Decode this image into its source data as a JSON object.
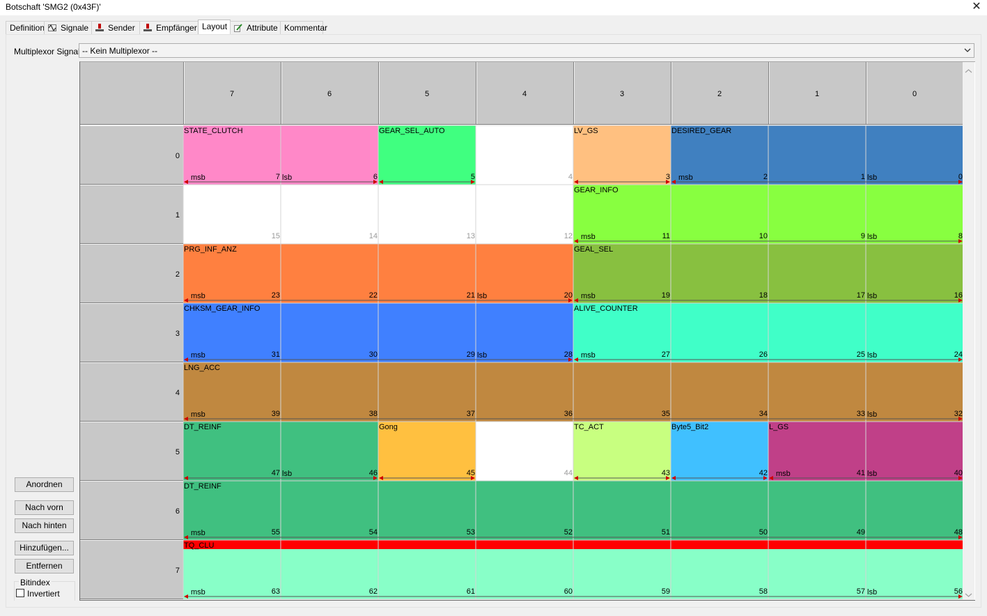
{
  "window": {
    "title": "Botschaft 'SMG2 (0x43F)'",
    "close": "✕"
  },
  "tabs": [
    {
      "label": "Definition",
      "icon": "",
      "active": false
    },
    {
      "label": "Signale",
      "icon": "signal-icon",
      "active": false
    },
    {
      "label": "Sender",
      "icon": "ecu-node-icon",
      "active": false
    },
    {
      "label": "Empfänger",
      "icon": "ecu-node-icon",
      "active": false
    },
    {
      "label": "Layout",
      "icon": "",
      "active": true
    },
    {
      "label": "Attribute",
      "icon": "pencil-edit-icon",
      "active": false
    },
    {
      "label": "Kommentar",
      "icon": "",
      "active": false
    }
  ],
  "multiplexor": {
    "label": "Multiplexor Signal:",
    "value": "-- Kein Multiplexor --"
  },
  "buttons": {
    "arrange": "Anordnen",
    "front": "Nach vorn",
    "back": "Nach hinten",
    "add": "Hinzufügen...",
    "remove": "Entfernen"
  },
  "bitindex": {
    "group": "Bitindex",
    "invert": "Invertiert",
    "checked": false
  },
  "layout": {
    "bit_headers": [
      "7",
      "6",
      "5",
      "4",
      "3",
      "2",
      "1",
      "0"
    ],
    "byte_headers": [
      "0",
      "1",
      "2",
      "3",
      "4",
      "5",
      "6",
      "7"
    ],
    "msb_label": "msb",
    "lsb_label": "lsb",
    "colors": {
      "empty_cell": "#ffffff",
      "header": "#c8c8c8",
      "grid_line": "#d4d4d4",
      "arrow": "#d00000",
      "tq_clu_bar": "#ff0000"
    },
    "signals": [
      {
        "name": "STATE_CLUTCH",
        "byte": 0,
        "from_col": 0,
        "to_col": 1,
        "color": "#ff88c8",
        "msb_col": 0,
        "lsb_col": 1
      },
      {
        "name": "GEAR_SEL_AUTO",
        "byte": 0,
        "from_col": 2,
        "to_col": 2,
        "color": "#40ff80",
        "msb_col": null,
        "lsb_col": null
      },
      {
        "name": "LV_GS",
        "byte": 0,
        "from_col": 4,
        "to_col": 4,
        "color": "#ffc080",
        "msb_col": null,
        "lsb_col": null
      },
      {
        "name": "DESIRED_GEAR",
        "byte": 0,
        "from_col": 5,
        "to_col": 7,
        "color": "#4080c0",
        "msb_col": 5,
        "lsb_col": 7
      },
      {
        "name": "GEAR_INFO",
        "byte": 1,
        "from_col": 4,
        "to_col": 7,
        "color": "#88ff40",
        "msb_col": 4,
        "lsb_col": 7
      },
      {
        "name": "PRG_INF_ANZ",
        "byte": 2,
        "from_col": 0,
        "to_col": 3,
        "color": "#ff8040",
        "msb_col": 0,
        "lsb_col": 3
      },
      {
        "name": "GEAL_SEL",
        "byte": 2,
        "from_col": 4,
        "to_col": 7,
        "color": "#88c040",
        "msb_col": 4,
        "lsb_col": 7
      },
      {
        "name": "CHKSM_GEAR_INFO",
        "byte": 3,
        "from_col": 0,
        "to_col": 3,
        "color": "#4080ff",
        "msb_col": 0,
        "lsb_col": 3
      },
      {
        "name": "ALIVE_COUNTER",
        "byte": 3,
        "from_col": 4,
        "to_col": 7,
        "color": "#40ffc8",
        "msb_col": 4,
        "lsb_col": 7
      },
      {
        "name": "LNG_ACC",
        "byte": 4,
        "from_col": 0,
        "to_col": 7,
        "color": "#c08840",
        "msb_col": 0,
        "lsb_col": 7
      },
      {
        "name": "DT_REINF",
        "byte": 5,
        "from_col": 0,
        "to_col": 1,
        "color": "#40c080",
        "msb_col": null,
        "lsb_col": 1
      },
      {
        "name": "Gong",
        "byte": 5,
        "from_col": 2,
        "to_col": 2,
        "color": "#ffc040",
        "msb_col": null,
        "lsb_col": null
      },
      {
        "name": "TC_ACT",
        "byte": 5,
        "from_col": 4,
        "to_col": 4,
        "color": "#c8ff80",
        "msb_col": null,
        "lsb_col": null
      },
      {
        "name": "Byte5_Bit2",
        "byte": 5,
        "from_col": 5,
        "to_col": 5,
        "color": "#40c0ff",
        "msb_col": null,
        "lsb_col": null
      },
      {
        "name": "L_GS",
        "byte": 5,
        "from_col": 6,
        "to_col": 7,
        "color": "#c04088",
        "msb_col": 6,
        "lsb_col": 7
      },
      {
        "name": "DT_REINF",
        "byte": 6,
        "from_col": 0,
        "to_col": 7,
        "color": "#40c080",
        "msb_col": 0,
        "lsb_col": null
      },
      {
        "name": "TQ_CLU",
        "byte": 7,
        "from_col": 0,
        "to_col": 7,
        "color": "#88ffc8",
        "msb_col": 0,
        "lsb_col": 7
      }
    ]
  }
}
